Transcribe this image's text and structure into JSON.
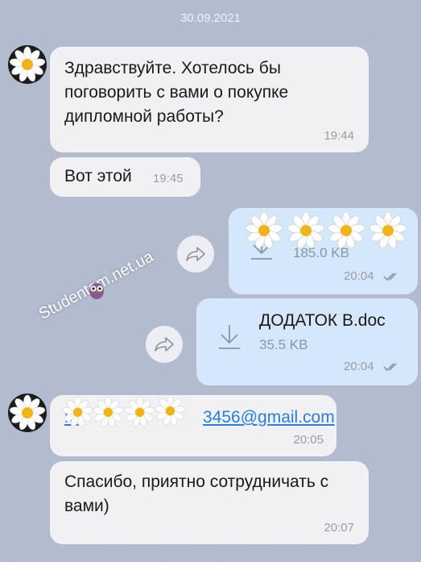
{
  "date_header": "30.09.2021",
  "messages": [
    {
      "text": "Здравствуйте. Хотелось бы поговорить с вами о покупке дипломной работы?",
      "time": "19:44"
    },
    {
      "text": "Вот этой",
      "time": "19:45"
    },
    {
      "file_size": "185.0 KB",
      "time": "20:04"
    },
    {
      "file_name": "ДОДАТОК В.doc",
      "file_size": "35.5 KB",
      "time": "20:04"
    },
    {
      "link_visible_start": "m",
      "link_visible_end": "3456@gmail.com",
      "time": "20:05"
    },
    {
      "text": "Спасибо, приятно сотрудничать с вами)",
      "time": "20:07"
    }
  ],
  "watermark": "Studentam.net.ua",
  "colors": {
    "background": "#b3bccf",
    "incoming": "#f1f1f3",
    "outgoing": "#d5e7fb",
    "link": "#2a7de0",
    "checks": "#8a96a6"
  },
  "icons": [
    "daisy-avatar-icon",
    "share-icon",
    "download-icon",
    "double-check-icon",
    "owl-icon",
    "daisy-sticker-icon"
  ]
}
